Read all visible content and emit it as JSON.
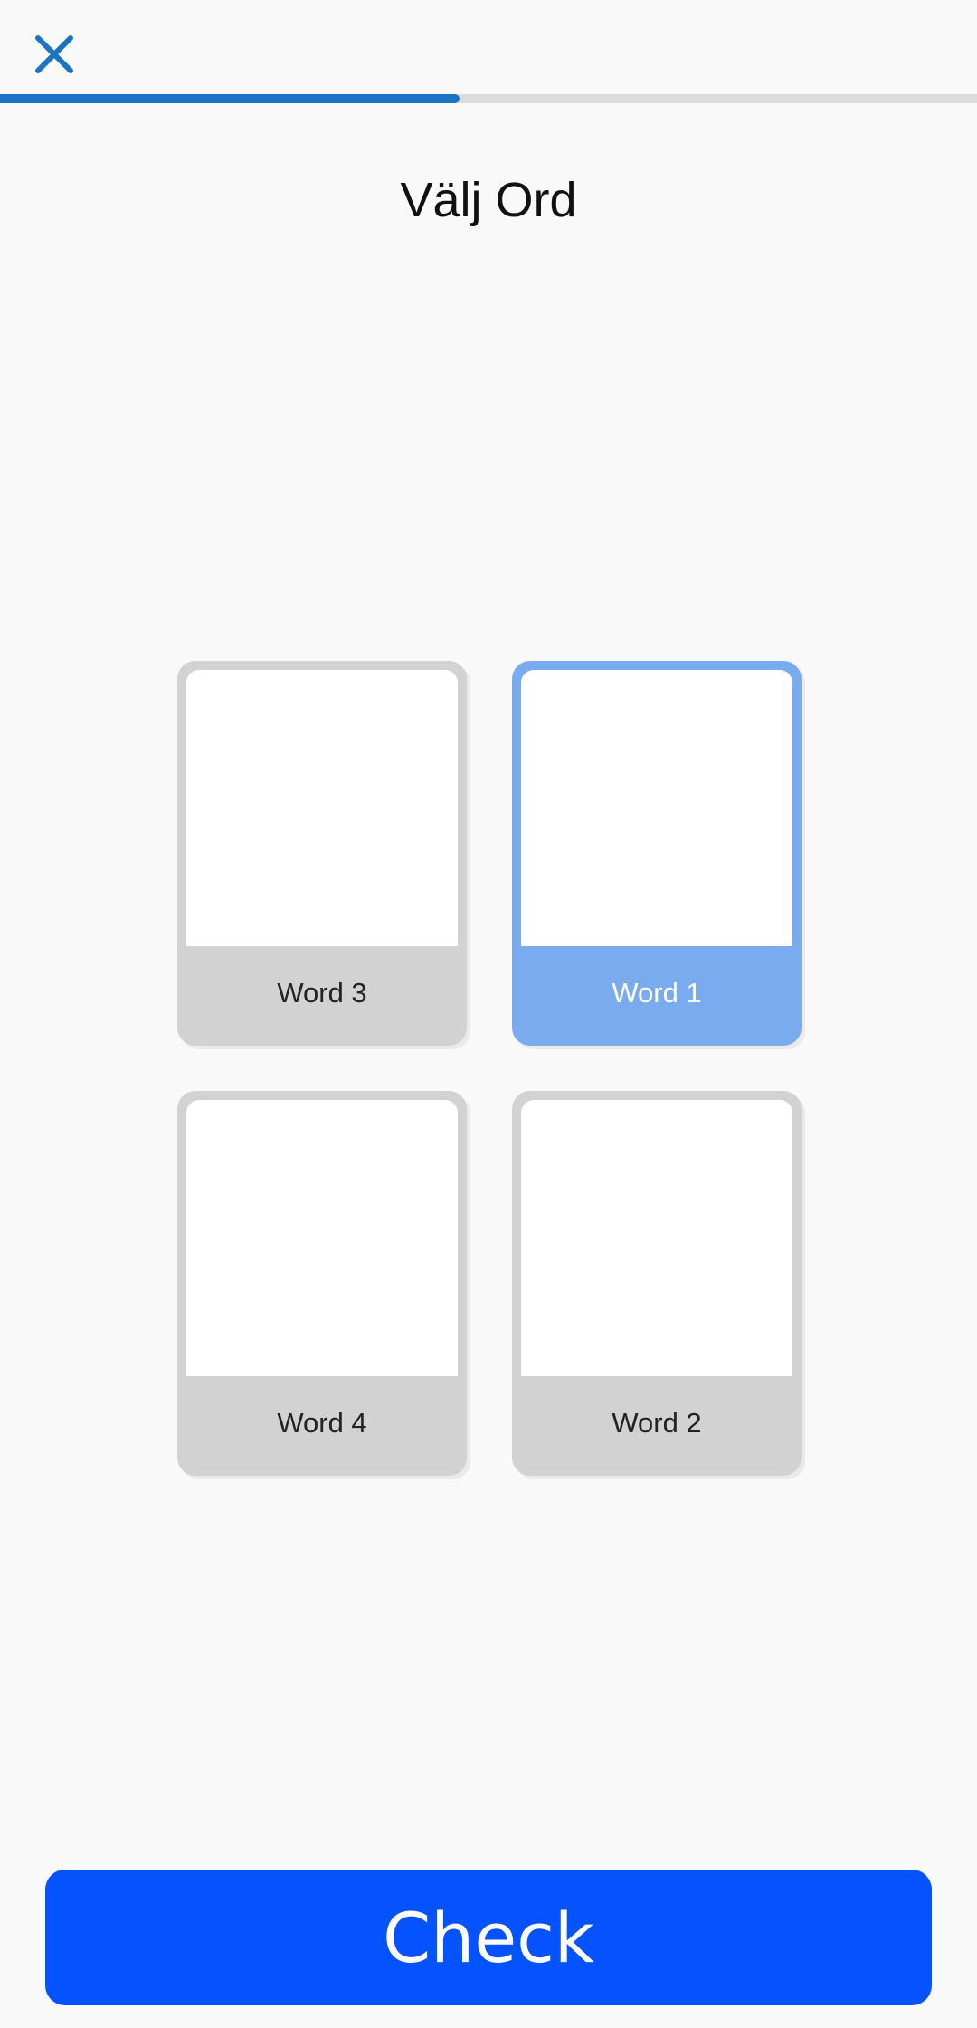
{
  "header": {
    "close_icon": "close-icon",
    "close_color": "#1a74c4",
    "progress": 0.47
  },
  "title": "Välj Ord",
  "cards": [
    {
      "label": "Word 3",
      "selected": false
    },
    {
      "label": "Word 1",
      "selected": true
    },
    {
      "label": "Word 4",
      "selected": false
    },
    {
      "label": "Word 2",
      "selected": false
    }
  ],
  "colors": {
    "selected": "#7aabee",
    "unselected": "#d2d2d2",
    "check_button": "#0552ff",
    "progress": "#1a74c4"
  },
  "check_button": {
    "label": "Check"
  }
}
